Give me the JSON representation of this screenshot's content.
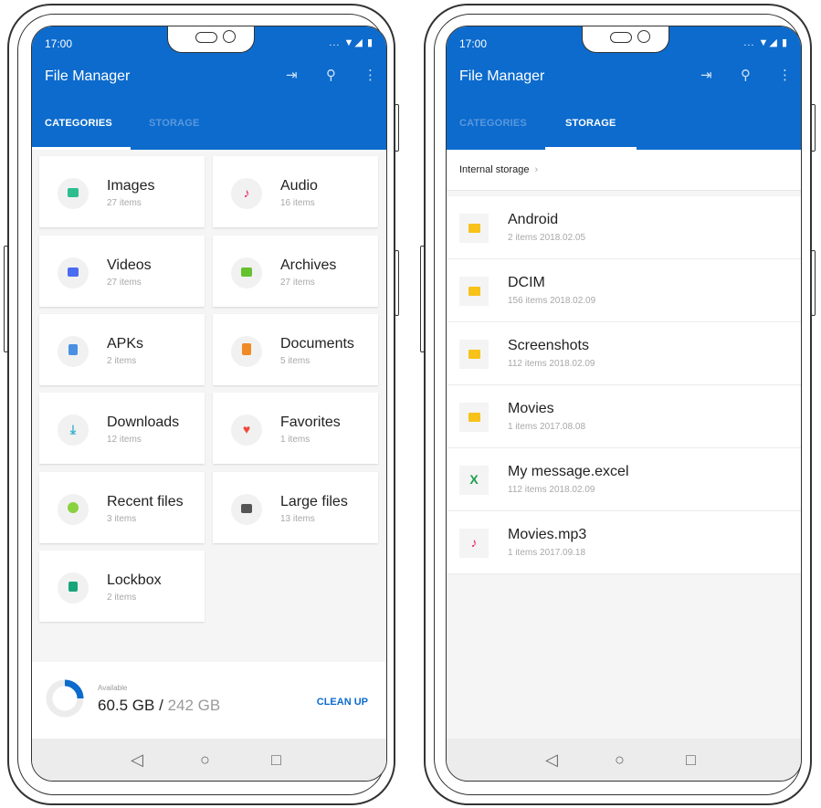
{
  "colors": {
    "appbar": "#0c6bcd",
    "accent": "#0c6bcd",
    "folder": "#f7c21a"
  },
  "status": {
    "time": "17:00",
    "icons": "... ▼◢ ▮"
  },
  "app": {
    "title": "File Manager"
  },
  "toolbar_icons": [
    "move-in-icon",
    "search-icon",
    "more-vert-icon"
  ],
  "tabs": {
    "categories": "CATEGORIES",
    "storage": "STORAGE"
  },
  "categories": [
    {
      "name": "Images",
      "count": "27 items",
      "icon": "image-icon",
      "color": "#2dbd8f"
    },
    {
      "name": "Audio",
      "count": "16 items",
      "icon": "music-note-icon",
      "color": "#e91e63"
    },
    {
      "name": "Videos",
      "count": "27 items",
      "icon": "video-icon",
      "color": "#4b6cf0"
    },
    {
      "name": "Archives",
      "count": "27 items",
      "icon": "archive-icon",
      "color": "#65c12e"
    },
    {
      "name": "APKs",
      "count": "2 items",
      "icon": "android-icon",
      "color": "#4a90e2"
    },
    {
      "name": "Documents",
      "count": "5 items",
      "icon": "document-icon",
      "color": "#f08a24"
    },
    {
      "name": "Downloads",
      "count": "12 items",
      "icon": "download-icon",
      "color": "#33b0c9"
    },
    {
      "name": "Favorites",
      "count": "1 items",
      "icon": "heart-icon",
      "color": "#ee4a3c"
    },
    {
      "name": "Recent files",
      "count": "3 items",
      "icon": "clock-icon",
      "color": "#8ad13f"
    },
    {
      "name": "Large files",
      "count": "13 items",
      "icon": "large-file-icon",
      "color": "#555555"
    },
    {
      "name": "Lockbox",
      "count": "2 items",
      "icon": "lock-icon",
      "color": "#17a57a"
    }
  ],
  "storage_summary": {
    "available_label": "Available",
    "used": "60.5 GB",
    "separator": "/",
    "total": "242 GB",
    "fraction_available": 0.25,
    "cleanup": "CLEAN UP"
  },
  "nav": {
    "back": "◁",
    "home": "○",
    "recents": "□"
  },
  "storage": {
    "breadcrumb": "Internal storage",
    "files": [
      {
        "name": "Android",
        "meta": "2 items  2018.02.05",
        "icon": "folder-icon"
      },
      {
        "name": "DCIM",
        "meta": "156 items  2018.02.09",
        "icon": "folder-icon"
      },
      {
        "name": "Screenshots",
        "meta": "112 items  2018.02.09",
        "icon": "folder-icon"
      },
      {
        "name": "Movies",
        "meta": "1 items  2017.08.08",
        "icon": "folder-icon"
      },
      {
        "name": "My message.excel",
        "meta": "112 items  2018.02.09",
        "icon": "excel-icon",
        "glyph": "X",
        "color": "#1e9d4f"
      },
      {
        "name": "Movies.mp3",
        "meta": "1 items  2017.09.18",
        "icon": "music-note-icon",
        "glyph": "♪",
        "color": "#e91e63"
      }
    ]
  }
}
